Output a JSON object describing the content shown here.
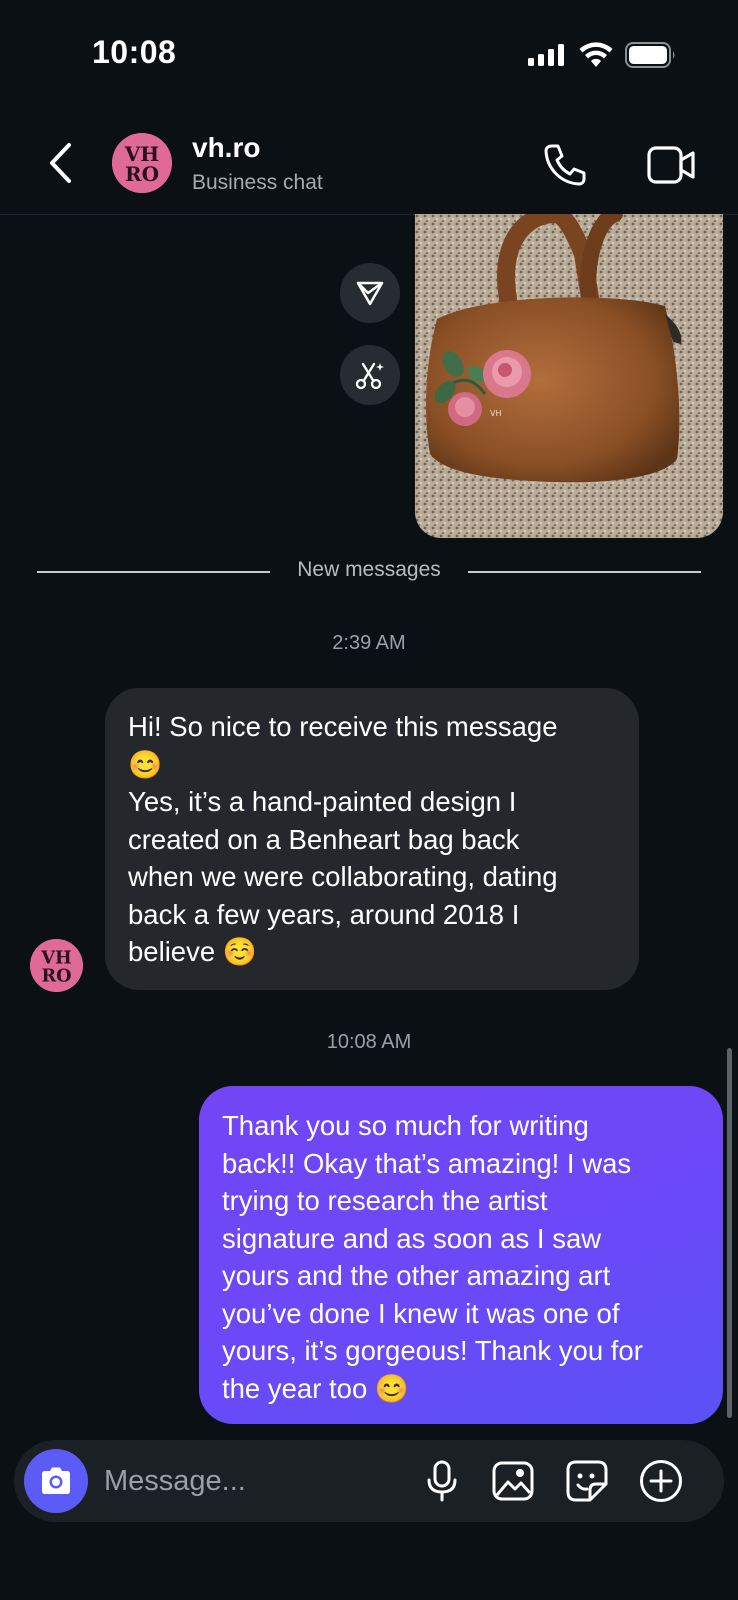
{
  "status_bar": {
    "time": "10:08"
  },
  "header": {
    "avatar_text": "VH RO",
    "title": "vh.ro",
    "subtitle": "Business chat"
  },
  "divider": {
    "label": "New messages"
  },
  "messages": [
    {
      "direction": "incoming",
      "timestamp": "2:39 AM",
      "text": "Hi! So nice to receive this message\n😊\nYes, it’s a hand-painted design I\ncreated on a Benheart bag back\nwhen we were collaborating, dating\nback a few years, around 2018 I\nbelieve ☺️"
    },
    {
      "direction": "outgoing",
      "timestamp": "10:08 AM",
      "text": "Thank you so much for writing\nback!! Okay that’s amazing! I was\ntrying to research the artist\nsignature and as soon as I saw\nyours and the other amazing art\nyou’ve done I knew it was one of\nyours, it’s gorgeous! Thank you for\nthe year too 😊"
    }
  ],
  "composer": {
    "placeholder": "Message..."
  },
  "icons": {
    "back": "chevron-left-icon",
    "call": "phone-icon",
    "video": "video-camera-icon",
    "share": "send-icon",
    "restyle": "ai-scissors-icon",
    "camera": "camera-icon",
    "mic": "microphone-icon",
    "gallery": "image-icon",
    "sticker": "sticker-icon",
    "more": "plus-icon"
  },
  "colors": {
    "background": "#0b1014",
    "incoming_bubble": "#24282d",
    "outgoing_bubble": "#6a49f8",
    "camera_button": "#5b5cf6",
    "avatar": "#e06a97"
  }
}
